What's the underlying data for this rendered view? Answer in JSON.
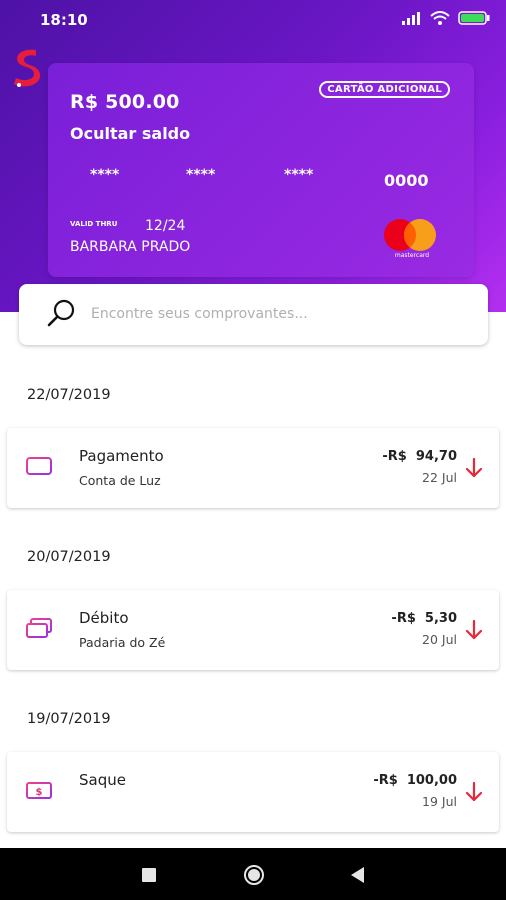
{
  "status_bar": {
    "time": "18:10"
  },
  "card": {
    "balance": "R$ 500.00",
    "hide_balance_label": "Ocultar saldo",
    "badge": "CARTÃO ADICIONAL",
    "number_groups": [
      "****",
      "****",
      "****",
      "0000"
    ],
    "valid_thru_label": "VALID THRU",
    "valid_thru": "12/24",
    "holder": "BARBARA PRADO",
    "brand": "mastercard"
  },
  "search": {
    "placeholder": "Encontre seus comprovantes..."
  },
  "sections": [
    {
      "date": "22/07/2019",
      "transaction": {
        "icon": "barcode-icon",
        "title": "Pagamento",
        "subtitle": "Conta de Luz",
        "amount": "-R$  94,70",
        "day": "22 Jul"
      }
    },
    {
      "date": "20/07/2019",
      "transaction": {
        "icon": "cards-icon",
        "title": "Débito",
        "subtitle": "Padaria do Zé",
        "amount": "-R$  5,30",
        "day": "20 Jul"
      }
    },
    {
      "date": "19/07/2019",
      "transaction": {
        "icon": "cash-icon",
        "title": "Saque",
        "subtitle": "",
        "amount": "-R$  100,00",
        "day": "19 Jul"
      }
    }
  ],
  "colors": {
    "header_start": "#4d12a6",
    "header_end": "#b42ff0",
    "icon_gradient_start": "#f0408a",
    "icon_gradient_end": "#9b2ee6",
    "arrow_red": "#e8283a"
  }
}
